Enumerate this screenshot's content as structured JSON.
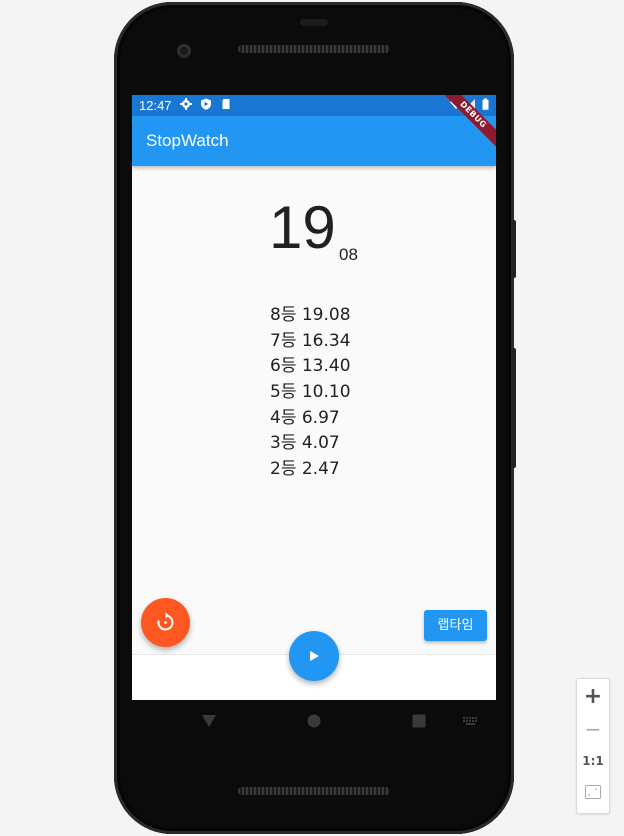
{
  "status_bar": {
    "time": "12:47",
    "left_icons": [
      "settings-icon",
      "play-protect-icon",
      "sd-card-icon"
    ],
    "right_icons": [
      "wifi-icon",
      "signal-icon",
      "battery-icon"
    ],
    "color": "#1976d2"
  },
  "app_bar": {
    "title": "StopWatch",
    "color": "#2196f3"
  },
  "debug_banner": "DEBUG",
  "timer": {
    "seconds": "19",
    "hundredths": "08"
  },
  "laps": [
    "8등 19.08",
    "7등 16.34",
    "6등 13.40",
    "5등 10.10",
    "4등 6.97",
    "3등 4.07",
    "2등 2.47"
  ],
  "buttons": {
    "lap_label": "랩타임",
    "reset_icon": "reset-icon",
    "play_icon": "play-icon",
    "reset_color": "#ff5722",
    "play_color": "#2196f3"
  },
  "nav_bar": [
    "back-icon",
    "home-icon",
    "recents-icon",
    "keyboard-icon"
  ],
  "zoom_controls": {
    "zoom_in": "+",
    "zoom_out": "−",
    "actual_size": "1:1",
    "fit_icon": "fit-screen-icon"
  }
}
